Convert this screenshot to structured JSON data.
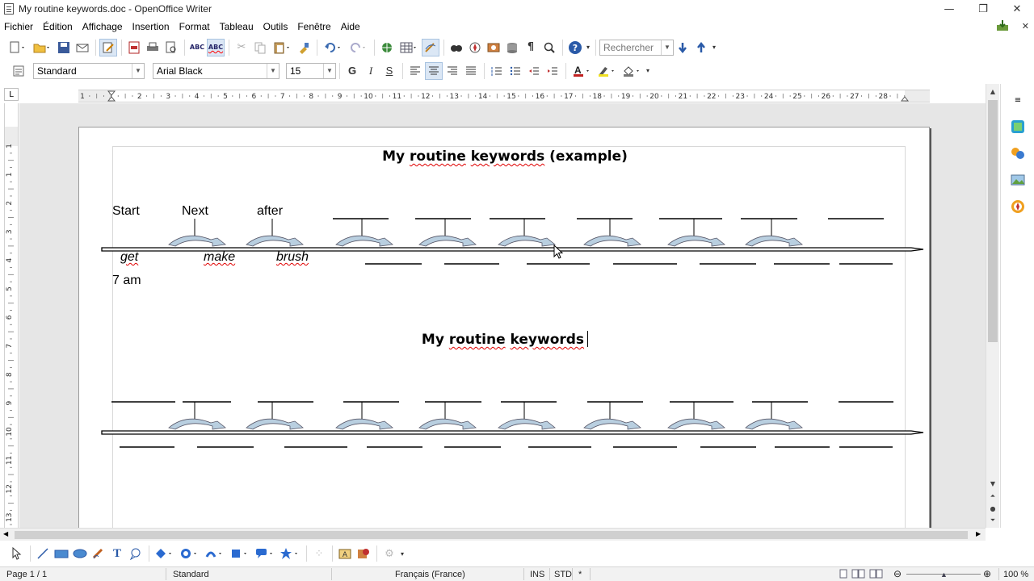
{
  "window": {
    "title": "My routine keywords.doc - OpenOffice Writer",
    "minimize_glyph": "—",
    "restore_glyph": "❐",
    "close_glyph": "✕"
  },
  "menu": {
    "items": [
      "Fichier",
      "Édition",
      "Affichage",
      "Insertion",
      "Format",
      "Tableau",
      "Outils",
      "Fenêtre",
      "Aide"
    ],
    "close_doc_glyph": "✕"
  },
  "toolbar": {
    "search_placeholder": "Rechercher",
    "icons": [
      "new-icon",
      "open-icon",
      "save-icon",
      "email-icon",
      "edit-file-icon",
      "export-pdf-icon",
      "print-icon",
      "print-preview-icon",
      "spellcheck-icon",
      "autospellcheck-icon",
      "cut-icon",
      "copy-icon",
      "paste-icon",
      "clone-format-icon",
      "undo-icon",
      "redo-icon",
      "hyperlink-icon",
      "table-icon",
      "draw-functions-icon",
      "find-replace-icon",
      "navigator-icon",
      "gallery-icon",
      "data-sources-icon",
      "formatting-marks-icon",
      "zoom-icon",
      "help-icon",
      "find-next-icon",
      "find-prev-icon"
    ]
  },
  "format_bar": {
    "style": "Standard",
    "font": "Arial Black",
    "size": "15",
    "bold": "G",
    "italic": "I",
    "underline": "S"
  },
  "ruler": {
    "labels": [
      "1",
      "1",
      "2",
      "3",
      "4",
      "5",
      "6",
      "7",
      "8",
      "9",
      "10",
      "11",
      "12",
      "13",
      "14",
      "15",
      "16",
      "17",
      "18",
      "19",
      "20",
      "21",
      "22",
      "23",
      "24",
      "25",
      "26",
      "27",
      "28"
    ],
    "vlabels": [
      "1",
      "1",
      "2",
      "3",
      "4",
      "5",
      "6",
      "7",
      "8",
      "9",
      "10",
      "11",
      "12",
      "13"
    ],
    "corner": "L"
  },
  "document": {
    "title1": "My routine keywords (example)",
    "title2": "My routine keywords",
    "top_words": [
      "Start",
      "Next",
      "after"
    ],
    "bottom_words": [
      "get",
      "make",
      "brush"
    ],
    "time_label": "7 am"
  },
  "statusbar": {
    "page": "Page 1 / 1",
    "style": "Standard",
    "language": "Français (France)",
    "ins": "INS",
    "std": "STD",
    "star": "*",
    "zoom": "100 %"
  },
  "colors": {
    "spell_underline": "#e00000",
    "arrow_fill": "#b9cfe0",
    "workspace": "#e6e6e6"
  }
}
